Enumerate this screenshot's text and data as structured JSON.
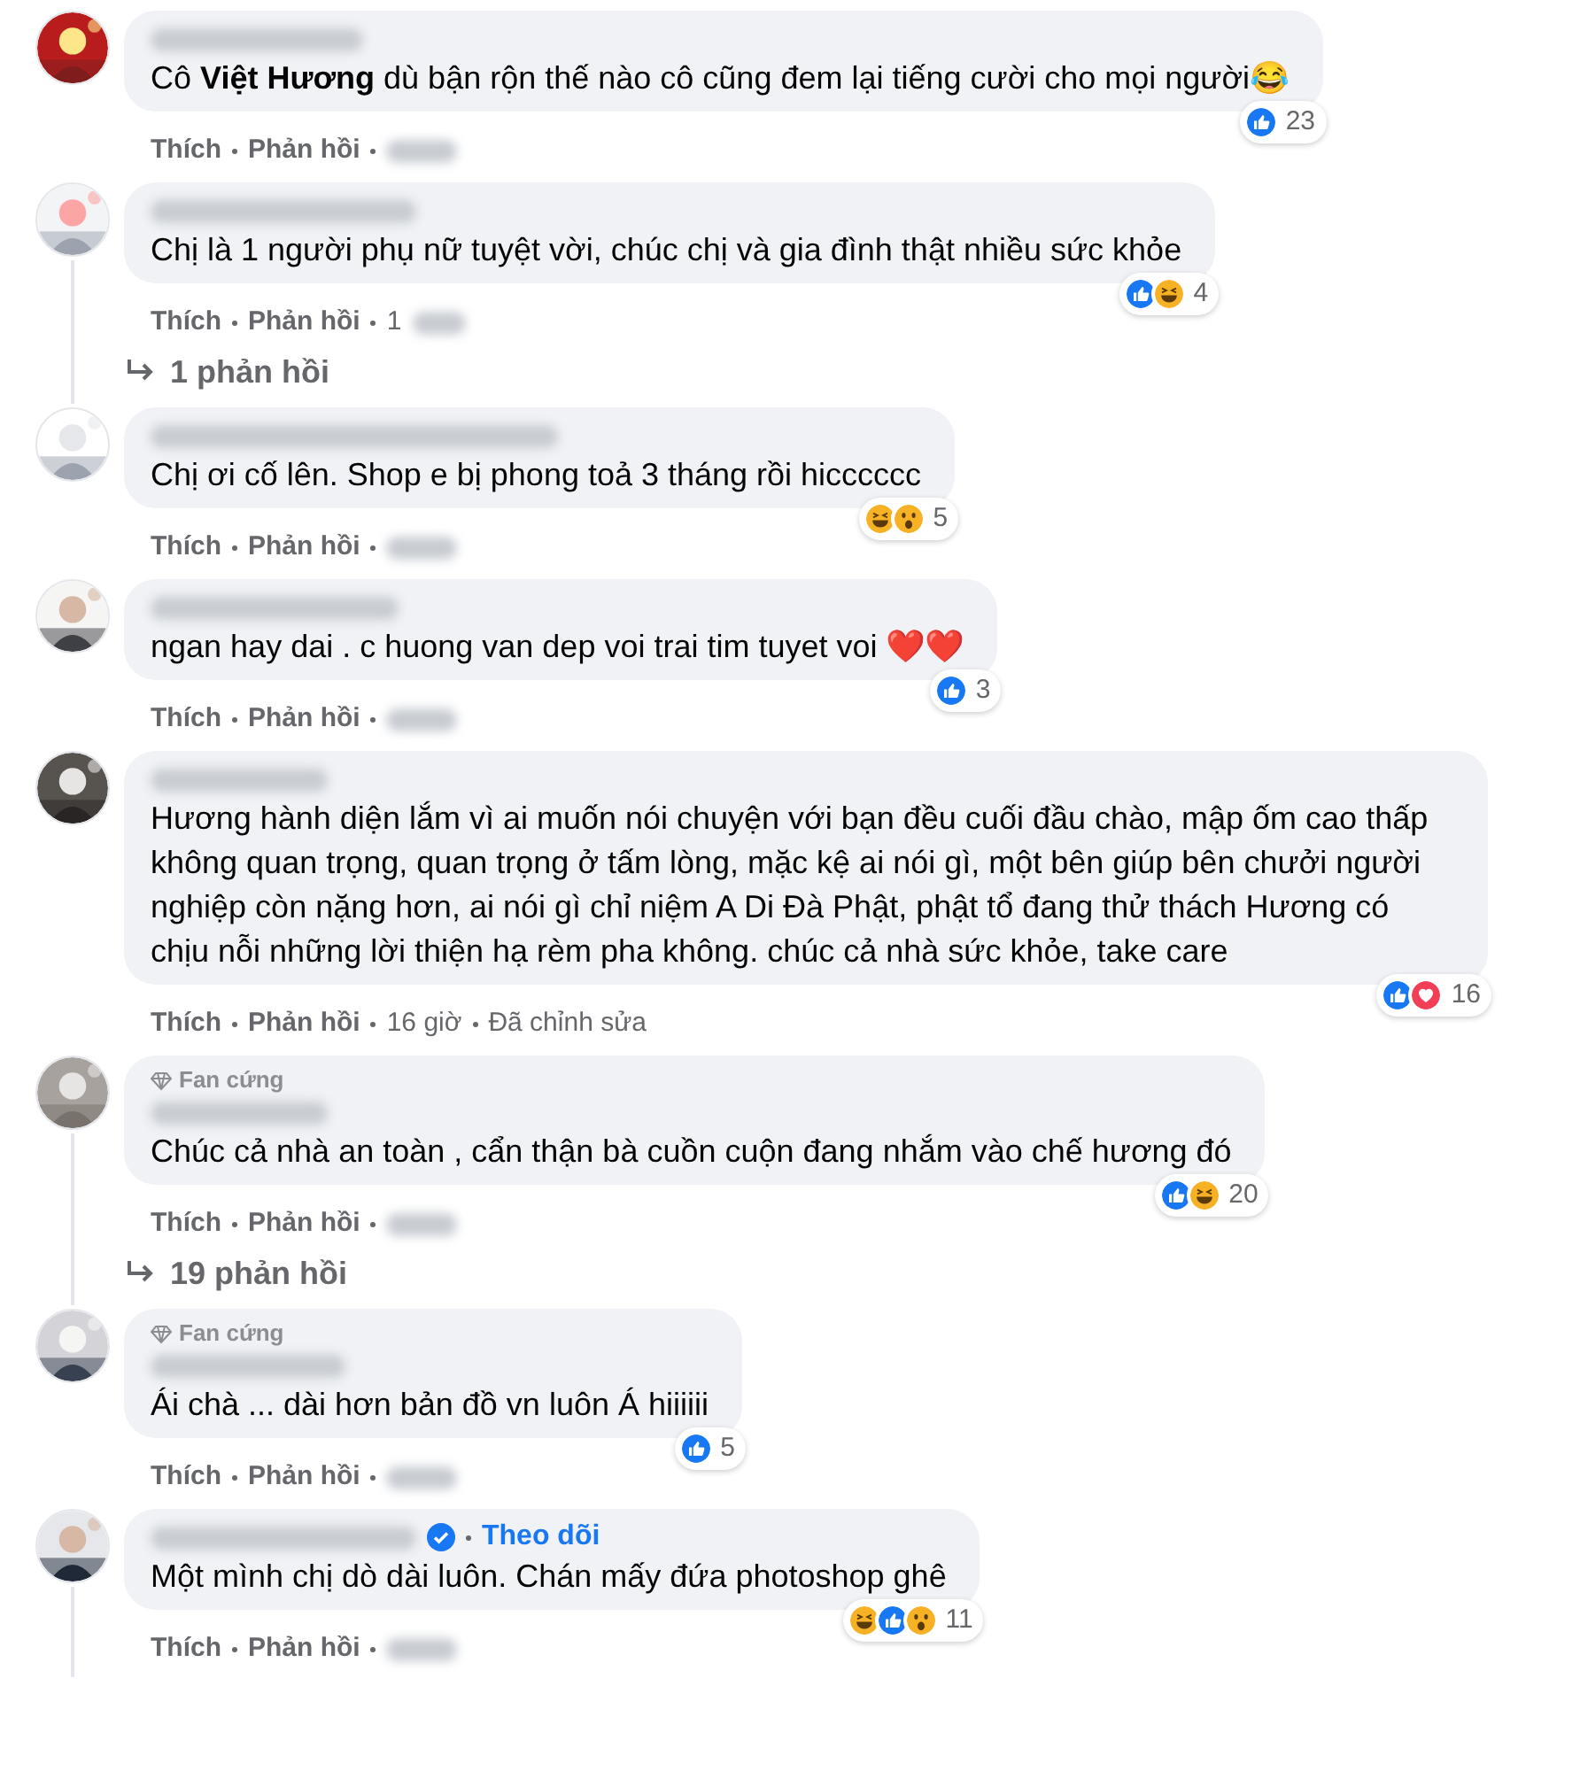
{
  "comments": [
    {
      "text": "Cô **Việt Hương** dù bận rộn thế nào cô cũng đem lại tiếng cười cho mọi người😂",
      "reactions": [
        {
          "kind": "like"
        }
      ],
      "count": "23",
      "actions": [
        "Thích",
        "Phản hồi"
      ]
    },
    {
      "text": "Chị là 1 người phụ nữ tuyệt vời, chúc chị và gia đình thật nhiều sức khỏe",
      "reactions": [
        {
          "kind": "like"
        },
        {
          "kind": "haha"
        }
      ],
      "count": "4",
      "actions": [
        "Thích",
        "Phản hồi"
      ],
      "time": "1",
      "replies": "1 phản hồi"
    },
    {
      "text": "Chị ơi cố lên. Shop e bị phong toả 3 tháng rồi hicccccc",
      "reactions": [
        {
          "kind": "haha"
        },
        {
          "kind": "wow"
        }
      ],
      "count": "5",
      "actions": [
        "Thích",
        "Phản hồi"
      ]
    },
    {
      "text": "ngan hay dai . c huong van dep voi trai tim tuyet voi ❤️❤️",
      "reactions": [
        {
          "kind": "like"
        }
      ],
      "count": "3",
      "actions": [
        "Thích",
        "Phản hồi"
      ]
    },
    {
      "text": "Hương hành diện lắm vì ai muốn nói chuyện với bạn đều cuối đầu chào, mập ốm cao thấp không quan trọng, quan trọng ở tấm lòng, mặc kệ ai nói gì, một bên giúp bên chưởi người nghiệp còn nặng hơn, ai nói gì chỉ niệm A Di Đà Phật, phật tổ đang thử thách Hương có chịu nỗi những lời thiện hạ rèm pha không. chúc cả nhà sức khỏe, take care",
      "reactions": [
        {
          "kind": "like"
        },
        {
          "kind": "love"
        }
      ],
      "count": "16",
      "actions": [
        "Thích",
        "Phản hồi"
      ],
      "time": "16 giờ",
      "edited": "Đã chỉnh sửa"
    },
    {
      "badge": "Fan cứng",
      "text": "Chúc cả nhà an toàn , cẩn thận bà cuồn cuộn đang nhắm vào chế hương đó",
      "reactions": [
        {
          "kind": "like"
        },
        {
          "kind": "haha"
        }
      ],
      "count": "20",
      "actions": [
        "Thích",
        "Phản hồi"
      ],
      "replies": "19 phản hồi"
    },
    {
      "badge": "Fan cứng",
      "text": "Ái chà ... dài hơn bản đồ vn luôn Á hiiiiii",
      "reactions": [
        {
          "kind": "like"
        }
      ],
      "count": "5",
      "actions": [
        "Thích",
        "Phản hồi"
      ]
    },
    {
      "verified": true,
      "follow": "Theo dõi",
      "text": "Một mình chị dò dài luôn. Chán mấy đứa photoshop ghê",
      "reactions": [
        {
          "kind": "haha"
        },
        {
          "kind": "like"
        },
        {
          "kind": "wow"
        }
      ],
      "count": "11",
      "actions": [
        "Thích",
        "Phản hồi"
      ],
      "thread": true
    }
  ]
}
